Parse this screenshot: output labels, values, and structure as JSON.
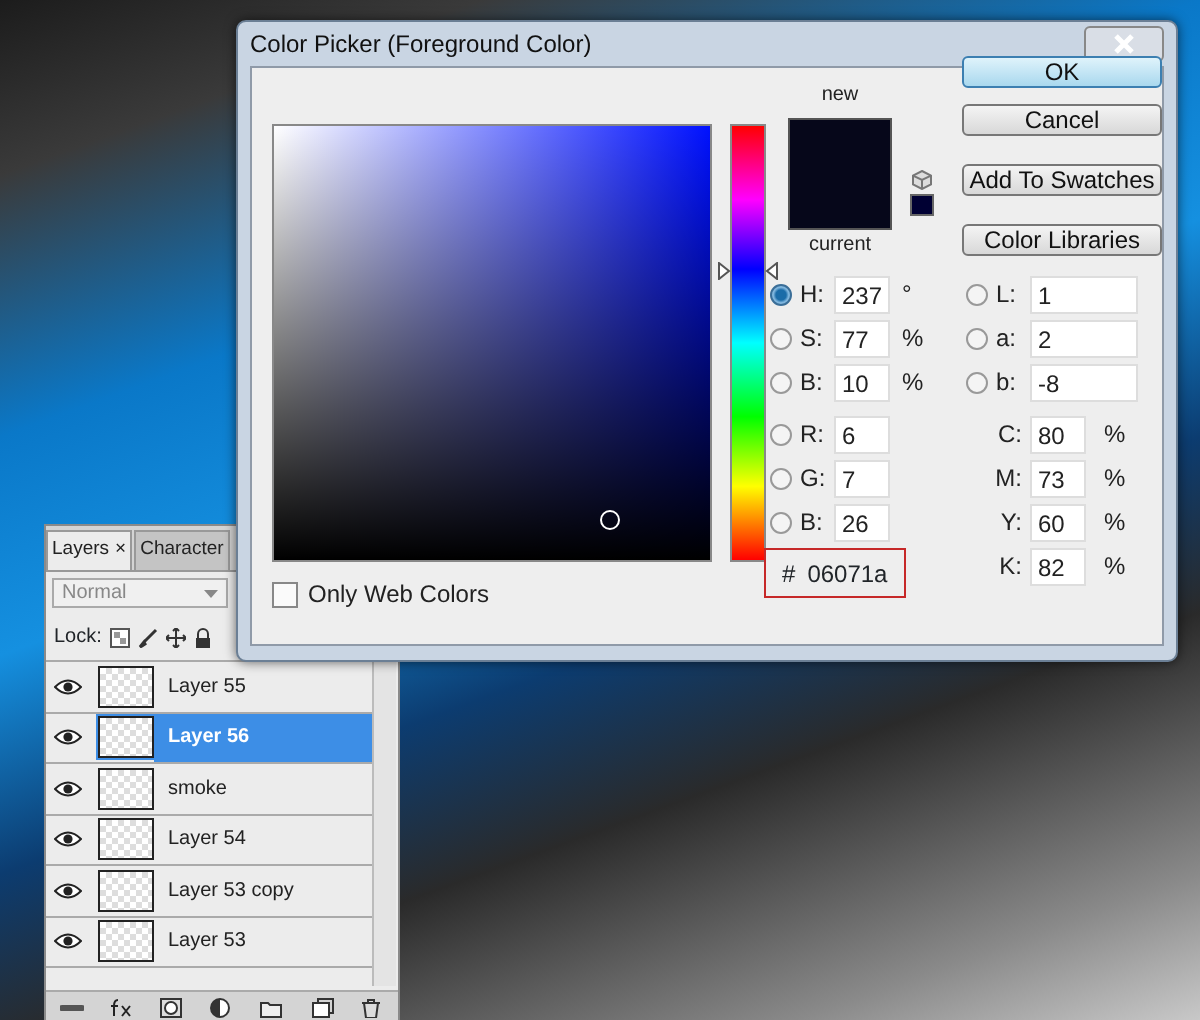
{
  "dialog": {
    "title": "Color Picker (Foreground Color)",
    "hue_slider": {
      "level": 0.66
    },
    "swatches": {
      "new_label": "new",
      "current_label": "current"
    },
    "buttons": [
      {
        "label": "OK",
        "default": true
      },
      {
        "label": "Cancel",
        "default": false
      },
      {
        "label": "Add To Swatches",
        "default": false
      },
      {
        "label": "Color Libraries",
        "default": false
      }
    ],
    "hsb": [
      {
        "label": "H:",
        "value": "237",
        "unit": "°",
        "selected": true
      },
      {
        "label": "S:",
        "value": "77",
        "unit": "%",
        "selected": false
      },
      {
        "label": "B:",
        "value": "10",
        "unit": "%",
        "selected": false
      }
    ],
    "rgb": [
      {
        "label": "R:",
        "value": "6",
        "selected": false
      },
      {
        "label": "G:",
        "value": "7",
        "selected": false
      },
      {
        "label": "B:",
        "value": "26",
        "selected": false
      }
    ],
    "lab": [
      {
        "label": "L:",
        "value": "1",
        "selected": false
      },
      {
        "label": "a:",
        "value": "2",
        "selected": false
      },
      {
        "label": "b:",
        "value": "-8",
        "selected": false
      }
    ],
    "cmyk": [
      {
        "label": "C:",
        "value": "80",
        "unit": "%"
      },
      {
        "label": "M:",
        "value": "73",
        "unit": "%"
      },
      {
        "label": "Y:",
        "value": "60",
        "unit": "%"
      },
      {
        "label": "K:",
        "value": "82",
        "unit": "%"
      }
    ],
    "hex": {
      "label": "#",
      "value": "06071a"
    },
    "only_web_colors": {
      "label": "Only Web Colors",
      "checked": false
    }
  },
  "layers_panel": {
    "tabs": [
      {
        "label": "Layers",
        "close": "×",
        "selected": true
      },
      {
        "label": "Character",
        "selected": false
      }
    ],
    "blend_mode": "Normal",
    "lock_label": "Lock:",
    "layers": [
      {
        "name": "Layer 55",
        "visible": true,
        "selected": false
      },
      {
        "name": "Layer 56",
        "visible": true,
        "selected": true
      },
      {
        "name": "smoke",
        "visible": true,
        "selected": false
      },
      {
        "name": "Layer 54",
        "visible": true,
        "selected": false
      },
      {
        "name": "Layer 53 copy",
        "visible": true,
        "selected": false
      },
      {
        "name": "Layer 53",
        "visible": true,
        "selected": false
      }
    ]
  }
}
